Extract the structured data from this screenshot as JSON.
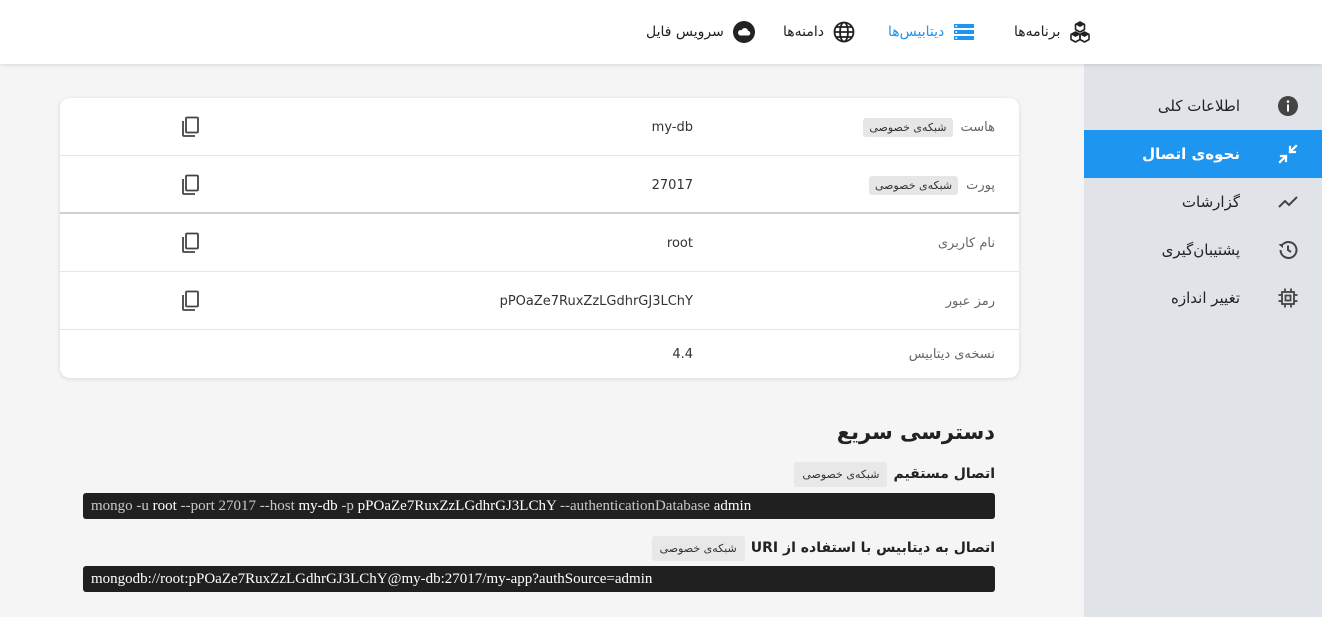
{
  "topnav": {
    "apps": "برنامه‌ها",
    "databases": "دیتابیس‌ها",
    "domains": "دامنه‌ها",
    "file_service": "سرویس فایل"
  },
  "sidebar": {
    "items": [
      {
        "label": "اطلاعات کلی",
        "icon": "info-icon"
      },
      {
        "label": "نحوه‌ی اتصال",
        "icon": "compress-arrows-icon"
      },
      {
        "label": "گزارشات",
        "icon": "trend-line-icon"
      },
      {
        "label": "پشتیبان‌گیری",
        "icon": "history-icon"
      },
      {
        "label": "تغییر اندازه",
        "icon": "chip-icon"
      }
    ]
  },
  "connection": {
    "host_label": "هاست",
    "host_chip": "شبکه‌ی خصوصی",
    "host_value": "my-db",
    "port_label": "پورت",
    "port_chip": "شبکه‌ی خصوصی",
    "port_value": "27017",
    "username_label": "نام کاربری",
    "username_value": "root",
    "password_label": "رمز عبور",
    "password_value": "pPOaZe7RuxZzLGdhrGJ3LChY",
    "version_label": "نسخه‌ی دیتابیس",
    "version_value": "4.4"
  },
  "quick_access": {
    "title": "دسترسی سریع",
    "direct_label": "اتصال مستقیم",
    "direct_chip": "شبکه‌ی خصوصی",
    "cmd": {
      "p1": "mongo -u ",
      "user": "root",
      "p2": " --port 27017 --host ",
      "host": "my-db",
      "p3": " -p ",
      "pass": "pPOaZe7RuxZzLGdhrGJ3LChY",
      "p4": " --authenticationDatabase ",
      "authdb": "admin"
    },
    "uri_label": "اتصال به دیتابیس با استفاده از URI",
    "uri_chip": "شبکه‌ی خصوصی",
    "uri": "mongodb://root:pPOaZe7RuxZzLGdhrGJ3LChY@my-db:27017/my-app?authSource=admin"
  },
  "colors": {
    "accent": "#1e96f0",
    "sidebar_bg": "#e0e4e8",
    "code_bg": "#202020"
  }
}
